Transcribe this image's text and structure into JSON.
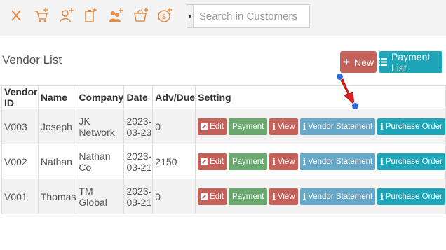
{
  "toolbar": {
    "icons": [
      "close-icon",
      "cart-add-icon",
      "user-add-icon",
      "clipboard-add-icon",
      "group-add-icon",
      "basket-add-icon",
      "coin-add-icon"
    ],
    "accent_color": "#e8893f",
    "search_placeholder": "Search in Customers"
  },
  "page": {
    "title": "Vendor List",
    "new_label": "New",
    "payment_list_label": "Payment List"
  },
  "table": {
    "headers": [
      "Vendor ID",
      "Name",
      "Company",
      "Date",
      "Adv/Due",
      "Setting"
    ],
    "rows": [
      {
        "vendor_id": "V003",
        "name": "Joseph",
        "company": "JK Network",
        "date": "2023-03-23",
        "adv_due": "0"
      },
      {
        "vendor_id": "V002",
        "name": "Nathan",
        "company": "Nathan Co",
        "date": "2023-03-21",
        "adv_due": "2150"
      },
      {
        "vendor_id": "V001",
        "name": "Thomas",
        "company": "TM Global",
        "date": "2023-03-21",
        "adv_due": "0"
      }
    ],
    "actions": {
      "edit": "Edit",
      "payment": "Payment",
      "view": "View",
      "vendor_statement": "Vendor Statement",
      "purchase_order": "Purchase Order"
    }
  },
  "colors": {
    "danger": "#c4615a",
    "success": "#6aa870",
    "info": "#67a8c9",
    "primary": "#1fa5b8"
  }
}
